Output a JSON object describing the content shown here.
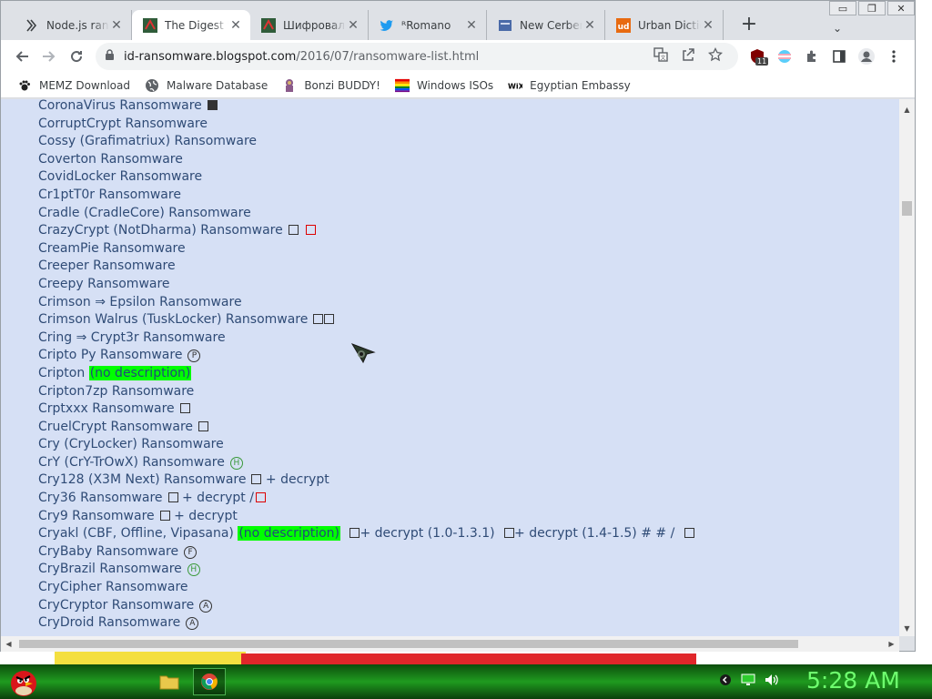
{
  "browser": {
    "tabs": [
      {
        "title": "Node.js ransomware",
        "favicon": "node-icon",
        "active": false
      },
      {
        "title": "The Digest \"",
        "favicon": "digest-icon",
        "active": true
      },
      {
        "title": "Шифровальщики",
        "favicon": "digest-icon",
        "active": false
      },
      {
        "title": "ᴿRomano",
        "favicon": "twitter-icon",
        "active": false
      },
      {
        "title": "New Cerber",
        "favicon": "doc-icon",
        "active": false
      },
      {
        "title": "Urban Dictionary",
        "favicon": "ud-icon",
        "active": false
      }
    ],
    "new_tab_label": "+",
    "tab_overflow_label": "⌄",
    "url_host": "id-ransomware.blogspot.com",
    "url_path": "/2016/07/ransomware-list.html",
    "extension_badge": "11",
    "bookmarks": [
      {
        "label": "MEMZ Download",
        "icon": "paw-icon"
      },
      {
        "label": "Malware Database",
        "icon": "globe-icon"
      },
      {
        "label": "Bonzi BUDDY!",
        "icon": "bonzi-icon"
      },
      {
        "label": "Windows ISOs",
        "icon": "rainbow-icon"
      },
      {
        "label": "Egyptian Embassy",
        "icon": "wix-icon"
      }
    ],
    "wix_text": "WiX"
  },
  "list": [
    {
      "name": "CoronaVirus Ransomware",
      "marks": "sqfill"
    },
    {
      "name": "CorruptCrypt Ransomware"
    },
    {
      "name": "Cossy (Grafimatriux) Ransomware"
    },
    {
      "name": "Coverton Ransomware"
    },
    {
      "name": "CovidLocker Ransomware"
    },
    {
      "name": "Cr1ptT0r Ransomware"
    },
    {
      "name": "Cradle (CradleCore) Ransomware"
    },
    {
      "name": "CrazyCrypt (NotDharma) Ransomware",
      "marks": "sq,sqred"
    },
    {
      "name": "CreamPie Ransomware"
    },
    {
      "name": "Creeper Ransomware"
    },
    {
      "name": "Creepy Ransomware"
    },
    {
      "name": "Crimson ⇒ Epsilon Ransomware"
    },
    {
      "name": "Crimson Walrus (TuskLocker) Ransomware",
      "marks": "sq2"
    },
    {
      "name": "Cring ⇒ Crypt3r Ransomware"
    },
    {
      "name": "Cripto Py Ransomware",
      "circle": "P"
    },
    {
      "name": "Cripton",
      "highlight": "(no description)"
    },
    {
      "name": "Cripton7zp Ransomware"
    },
    {
      "name": "Crptxxx Ransomware",
      "marks": "sq"
    },
    {
      "name": "CruelCrypt Ransomware",
      "marks": "sq"
    },
    {
      "name": "Cry (CryLocker) Ransomware"
    },
    {
      "name": "CrY (CrY-TrOwX) Ransomware",
      "circle": "H",
      "circle_green": true
    },
    {
      "name": "Cry128 (X3M Next) Ransomware",
      "marks": "sq",
      "extra": " + decrypt"
    },
    {
      "name": "Cry36 Ransomware",
      "marks": "sq",
      "extra": " + decrypt /",
      "tail": "sqred"
    },
    {
      "name": "Cry9 Ransomware",
      "marks": "sq",
      "extra": " + decrypt"
    },
    {
      "name": "Cryakl (CBF, Offline, Vipasana)",
      "highlight": "(no description)",
      "extra2": "+ decrypt (1.0-1.3.1)",
      "extra3": "+ decrypt (1.4-1.5) # # /"
    },
    {
      "name": "CryBaby Ransomware",
      "circle": "F"
    },
    {
      "name": "CryBrazil Ransomware",
      "circle": "H",
      "circle_green": true
    },
    {
      "name": "CryCipher Ransomware"
    },
    {
      "name": "CryCryptor Ransomware",
      "circle": "A"
    },
    {
      "name": "CryDroid Ransomware",
      "circle": "A"
    }
  ],
  "taskbar": {
    "clock": "5:28 AM"
  },
  "colors": {
    "page_bg": "#d6e0f5",
    "link": "#2f4b76",
    "highlight": "#00ff00",
    "taskbar": "#1f9b1f",
    "clock": "#6eff6e"
  }
}
